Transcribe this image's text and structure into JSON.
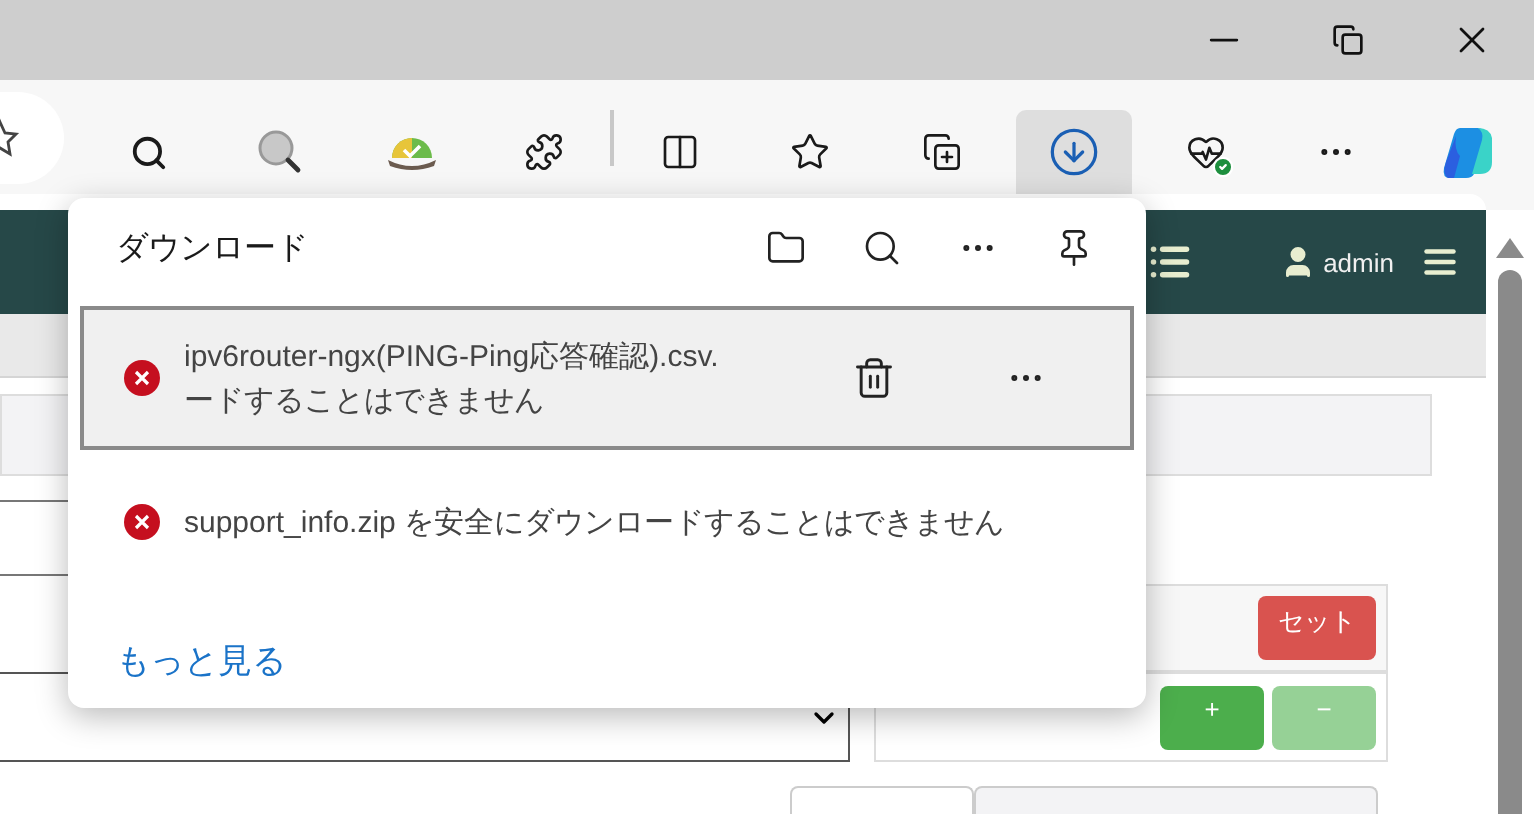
{
  "toolbar": {
    "items": [
      {
        "kind": "search",
        "selected": false
      },
      {
        "kind": "ip-lookup",
        "selected": false
      },
      {
        "kind": "weather",
        "selected": false
      },
      {
        "kind": "extensions",
        "selected": false
      },
      {
        "kind": "split",
        "selected": false
      },
      {
        "kind": "favorites",
        "selected": false
      },
      {
        "kind": "collections",
        "selected": false
      },
      {
        "kind": "downloads",
        "selected": true
      },
      {
        "kind": "health",
        "selected": false
      },
      {
        "kind": "more",
        "selected": false
      },
      {
        "kind": "copilot",
        "selected": false
      }
    ]
  },
  "downloads": {
    "title": "ダウンロード",
    "items": [
      {
        "name": "ipv6router-ngx(PING-Ping応答確認).csv.",
        "detail": "ードすることはできません",
        "error": true,
        "selected": true
      },
      {
        "name": "support_info.zip を安全にダウンロードすることはできません",
        "error": true,
        "selected": false
      }
    ],
    "more_link": "もっと見る"
  },
  "page": {
    "user": "admin",
    "buttons": [
      {
        "label": "セット",
        "kind": "danger"
      },
      {
        "label": "+",
        "kind": "add"
      },
      {
        "label": "−",
        "kind": "remove"
      }
    ]
  }
}
